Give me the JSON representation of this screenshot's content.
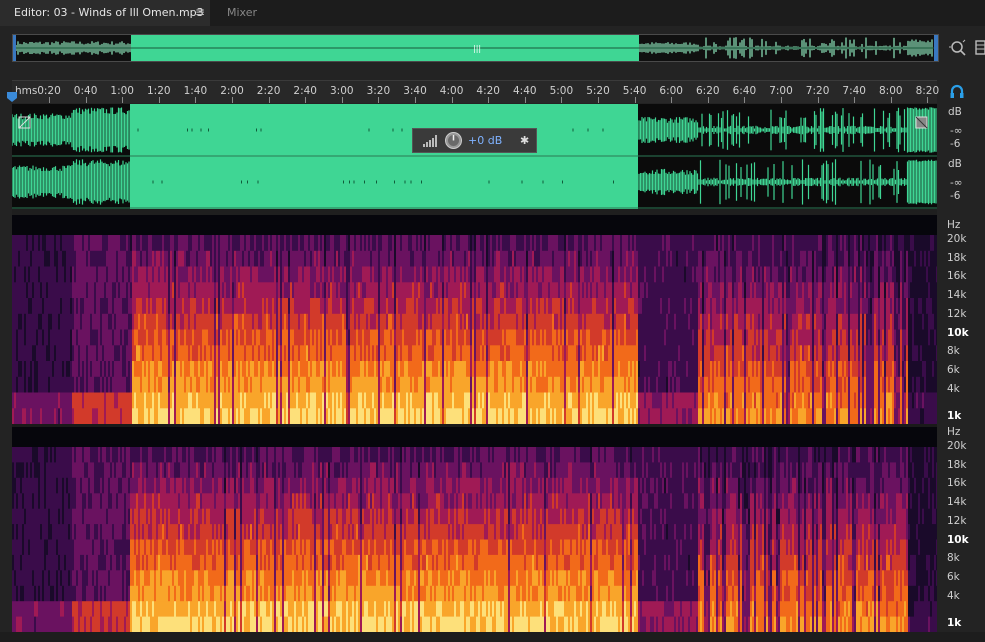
{
  "tabs": [
    {
      "label": "Editor: 03 - Winds of Ill Omen.mp3",
      "menu_icon": "hamburger-icon",
      "active": true
    },
    {
      "label": "Mixer",
      "active": false
    }
  ],
  "ruler": {
    "unit": "hms",
    "ticks": [
      "0:20",
      "0:40",
      "1:00",
      "1:20",
      "1:40",
      "2:00",
      "2:20",
      "2:40",
      "3:00",
      "3:20",
      "3:40",
      "4:00",
      "4:20",
      "4:40",
      "5:00",
      "5:20",
      "5:40",
      "6:00",
      "6:20",
      "6:40",
      "7:00",
      "7:20",
      "7:40",
      "8:00",
      "8:20"
    ]
  },
  "hud": {
    "gain_label": "+0 dB",
    "icons": [
      "level-bars-icon",
      "volume-knob-icon",
      "pin-icon"
    ]
  },
  "amplitude_scale": {
    "channel_1": [
      "dB",
      "-∞",
      "-6"
    ],
    "channel_2": [
      "dB",
      "-∞",
      "-6"
    ]
  },
  "frequency_scale": {
    "unit": "Hz",
    "labels": [
      "20k",
      "18k",
      "16k",
      "14k",
      "12k",
      "10k",
      "8k",
      "6k",
      "4k",
      "1k"
    ],
    "bold": [
      "10k",
      "1k"
    ]
  },
  "selection_color": "#3fd694",
  "waveform_color": "#3fd694",
  "right_icons": [
    "zoom-icon",
    "panel-icon",
    "loop-icon"
  ]
}
